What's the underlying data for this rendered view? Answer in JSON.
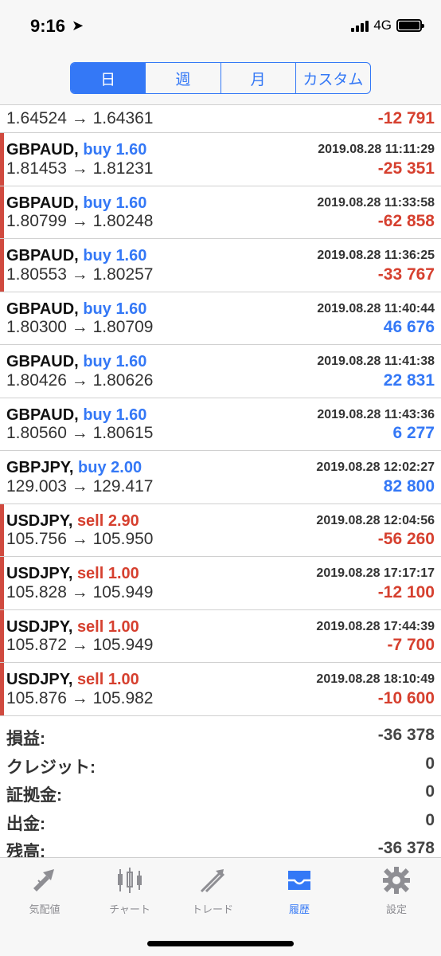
{
  "status": {
    "time": "9:16",
    "network": "4G"
  },
  "period_tabs": [
    "日",
    "週",
    "月",
    "カスタム"
  ],
  "partial_row": {
    "prices": "1.64524 → 1.64361",
    "profit": "-12 791"
  },
  "trades": [
    {
      "symbol": "GBPAUD,",
      "direction": "buy",
      "volume": "1.60",
      "time": "2019.08.28 11:11:29",
      "prices": "1.81453 → 1.81231",
      "profit": "-25 351"
    },
    {
      "symbol": "GBPAUD,",
      "direction": "buy",
      "volume": "1.60",
      "time": "2019.08.28 11:33:58",
      "prices": "1.80799 → 1.80248",
      "profit": "-62 858"
    },
    {
      "symbol": "GBPAUD,",
      "direction": "buy",
      "volume": "1.60",
      "time": "2019.08.28 11:36:25",
      "prices": "1.80553 → 1.80257",
      "profit": "-33 767"
    },
    {
      "symbol": "GBPAUD,",
      "direction": "buy",
      "volume": "1.60",
      "time": "2019.08.28 11:40:44",
      "prices": "1.80300 → 1.80709",
      "profit": "46 676"
    },
    {
      "symbol": "GBPAUD,",
      "direction": "buy",
      "volume": "1.60",
      "time": "2019.08.28 11:41:38",
      "prices": "1.80426 → 1.80626",
      "profit": "22 831"
    },
    {
      "symbol": "GBPAUD,",
      "direction": "buy",
      "volume": "1.60",
      "time": "2019.08.28 11:43:36",
      "prices": "1.80560 → 1.80615",
      "profit": "6 277"
    },
    {
      "symbol": "GBPJPY,",
      "direction": "buy",
      "volume": "2.00",
      "time": "2019.08.28 12:02:27",
      "prices": "129.003 → 129.417",
      "profit": "82 800"
    },
    {
      "symbol": "USDJPY,",
      "direction": "sell",
      "volume": "2.90",
      "time": "2019.08.28 12:04:56",
      "prices": "105.756 → 105.950",
      "profit": "-56 260"
    },
    {
      "symbol": "USDJPY,",
      "direction": "sell",
      "volume": "1.00",
      "time": "2019.08.28 17:17:17",
      "prices": "105.828 → 105.949",
      "profit": "-12 100"
    },
    {
      "symbol": "USDJPY,",
      "direction": "sell",
      "volume": "1.00",
      "time": "2019.08.28 17:44:39",
      "prices": "105.872 → 105.949",
      "profit": "-7 700"
    },
    {
      "symbol": "USDJPY,",
      "direction": "sell",
      "volume": "1.00",
      "time": "2019.08.28 18:10:49",
      "prices": "105.876 → 105.982",
      "profit": "-10 600"
    }
  ],
  "summary": [
    {
      "label": "損益:",
      "value": "-36 378"
    },
    {
      "label": "クレジット:",
      "value": "0"
    },
    {
      "label": "証拠金:",
      "value": "0"
    },
    {
      "label": "出金:",
      "value": "0"
    },
    {
      "label": "残高:",
      "value": "-36 378"
    }
  ],
  "tabbar": [
    {
      "label": "気配値",
      "icon": "quotes-icon"
    },
    {
      "label": "チャート",
      "icon": "chart-icon"
    },
    {
      "label": "トレード",
      "icon": "trade-icon"
    },
    {
      "label": "履歴",
      "icon": "history-icon"
    },
    {
      "label": "設定",
      "icon": "settings-icon"
    }
  ],
  "colors": {
    "accent": "#3478f6",
    "loss": "#d6402f",
    "loss_bar": "#d04a3f"
  }
}
